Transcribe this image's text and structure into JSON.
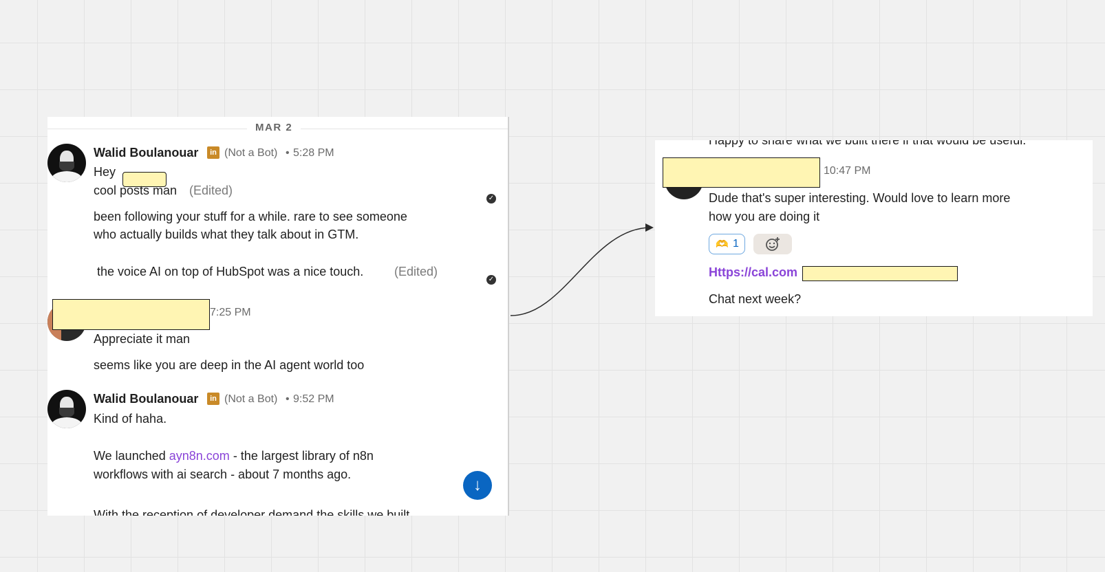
{
  "left_panel": {
    "date_label": "MAR 2",
    "messages": [
      {
        "sender": "Walid Boulanouar",
        "badge_icon": "linkedin-icon",
        "badge_text": "in",
        "bot_label": "(Not a Bot)",
        "separator": "•",
        "time": "5:28 PM",
        "line_1": "Hey",
        "line_2": "cool posts man",
        "line_2_edited": "(Edited)",
        "para_1_line_1": "been following your stuff for a while. rare to see someone",
        "para_1_line_2": "who actually builds what they talk about in GTM.",
        "para_2": " the voice AI on top of HubSpot was a nice touch.",
        "para_2_edited": "(Edited)"
      },
      {
        "time": "7:25 PM",
        "line_1": "Appreciate it man",
        "line_2": "seems like you are deep in the AI agent world too"
      },
      {
        "sender": "Walid Boulanouar",
        "badge_text": "in",
        "bot_label": "(Not a Bot)",
        "separator": "•",
        "time": "9:52 PM",
        "line_1": "Kind of haha.",
        "line_2_prefix": "We launched ",
        "line_2_link": "ayn8n.com",
        "line_2_suffix": " - the largest library of n8n",
        "line_3": "workflows with ai search - about 7 months ago.",
        "line_4_partial": "With the reception of developer demand the skills we built"
      }
    ],
    "scroll_button_icon": "arrow-down-icon",
    "scroll_button_glyph": "↓"
  },
  "right_panel": {
    "top_cut_text": "Happy to share what we built there if that would be useful.",
    "time": "10:47 PM",
    "msg_line_1": "Dude that's super interesting. Would love to learn more",
    "msg_line_2": "how you are doing it",
    "reaction_emoji": "🫶",
    "reaction_count": "1",
    "add_reaction_icon": "add-reaction-icon",
    "link_text": "Https://cal.com",
    "closing": "Chat next week?"
  },
  "colors": {
    "link": "#8a44d8",
    "accent_blue": "#0a66c2",
    "redaction": "#fff5b3",
    "linkedin_badge": "#c98a28"
  }
}
